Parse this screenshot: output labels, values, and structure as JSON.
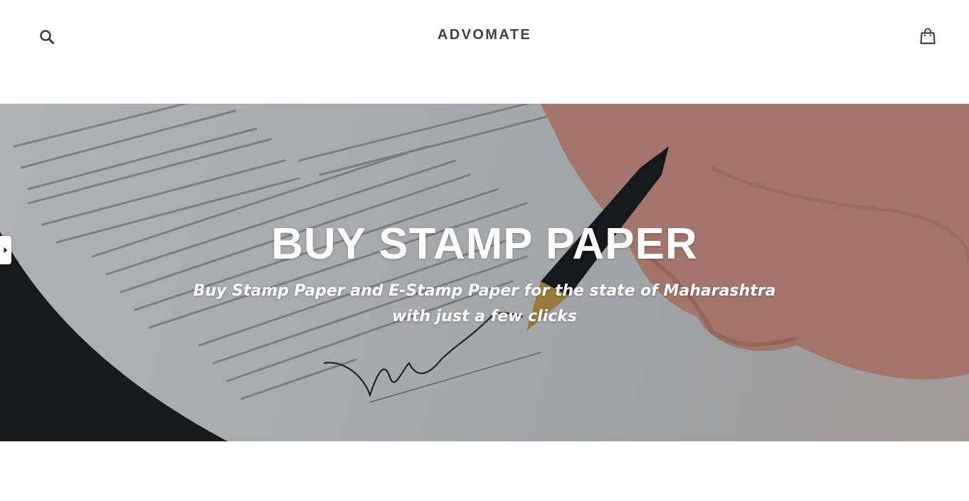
{
  "header": {
    "search_icon": "search-icon",
    "logo_text": "ADVOMATE",
    "cart_icon": "cart-icon"
  },
  "hero": {
    "title": "BUY STAMP PAPER",
    "subtitle_line1": "Buy Stamp Paper and E-Stamp Paper for the state of Maharashtra",
    "subtitle_line2": "with just a few clicks",
    "text_color": "#ffffff"
  },
  "side_tab": {
    "icon": "caret-right-icon"
  },
  "colors": {
    "header_text": "#3d4246",
    "background": "#ffffff"
  }
}
